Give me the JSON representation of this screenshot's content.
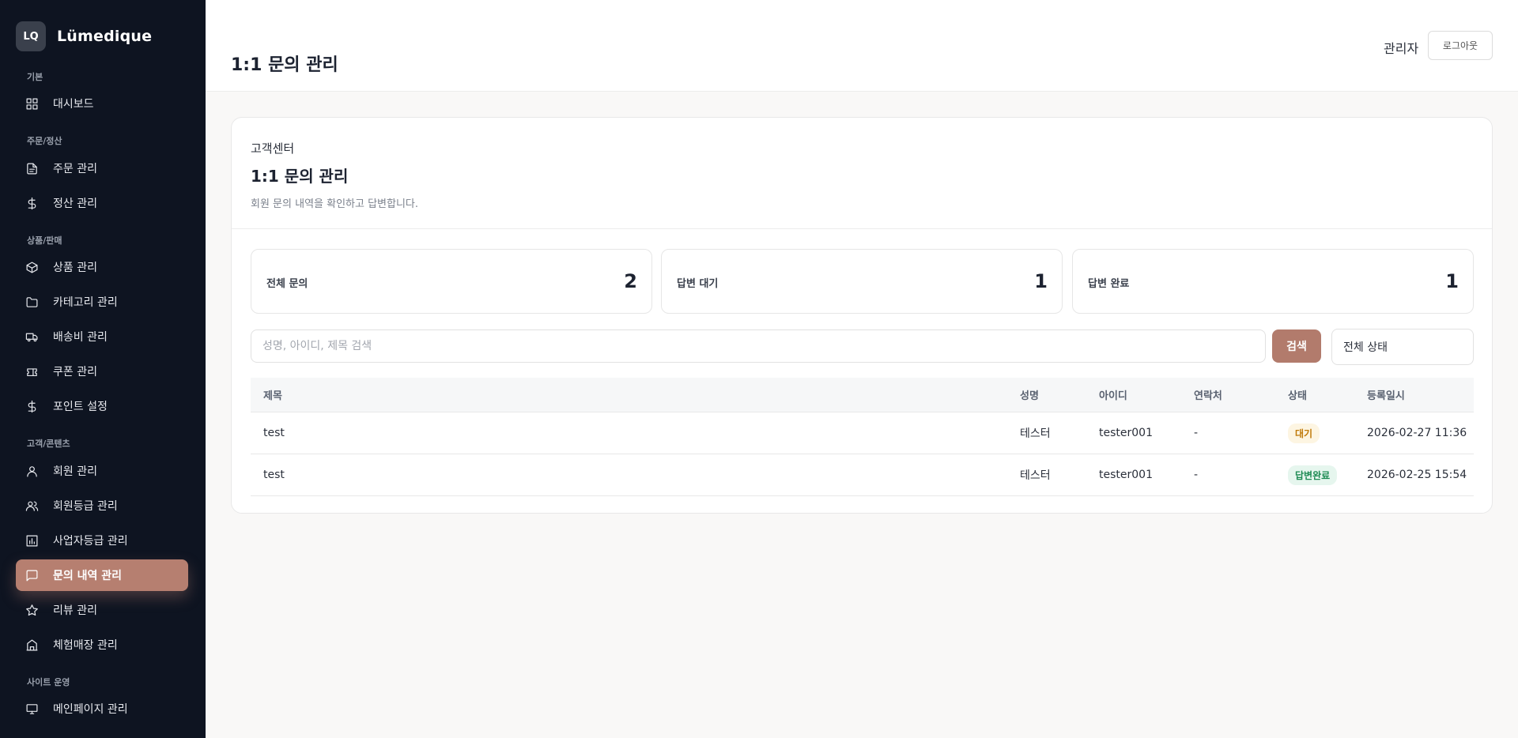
{
  "brand": {
    "logo": "LQ",
    "name": "Lümedique"
  },
  "sidebar": {
    "sections": [
      {
        "label": "기본"
      },
      {
        "label": "주문/정산"
      },
      {
        "label": "상품/판매"
      },
      {
        "label": "고객/콘텐츠"
      },
      {
        "label": "사이트 운영"
      }
    ],
    "items": [
      {
        "label": "대시보드",
        "icon": "grid-icon"
      },
      {
        "label": "주문 관리",
        "icon": "document-icon"
      },
      {
        "label": "정산 관리",
        "icon": "dollar-icon"
      },
      {
        "label": "상품 관리",
        "icon": "box-icon"
      },
      {
        "label": "카테고리 관리",
        "icon": "folder-icon"
      },
      {
        "label": "배송비 관리",
        "icon": "truck-icon"
      },
      {
        "label": "쿠폰 관리",
        "icon": "coupon-icon"
      },
      {
        "label": "포인트 설정",
        "icon": "dollar-icon"
      },
      {
        "label": "회원 관리",
        "icon": "user-icon"
      },
      {
        "label": "회원등급 관리",
        "icon": "users-icon"
      },
      {
        "label": "사업자등급 관리",
        "icon": "bar-chart-icon"
      },
      {
        "label": "문의 내역 관리",
        "icon": "message-icon",
        "active": true
      },
      {
        "label": "리뷰 관리",
        "icon": "star-icon"
      },
      {
        "label": "체험매장 관리",
        "icon": "building-icon"
      },
      {
        "label": "메인페이지 관리",
        "icon": "monitor-icon"
      }
    ]
  },
  "topbar": {
    "title": "1:1 문의 관리",
    "user": "관리자",
    "logout": "로그아웃"
  },
  "card": {
    "eyebrow": "고객센터",
    "title": "1:1 문의 관리",
    "desc": "회원 문의 내역을 확인하고 답변합니다."
  },
  "stats": [
    {
      "label": "전체 문의",
      "value": "2"
    },
    {
      "label": "답변 대기",
      "value": "1"
    },
    {
      "label": "답변 완료",
      "value": "1"
    }
  ],
  "search": {
    "placeholder": "성명, 아이디, 제목 검색",
    "button": "검색",
    "status_filter": "전체 상태"
  },
  "table": {
    "headers": {
      "title": "제목",
      "name": "성명",
      "id": "아이디",
      "phone": "연락처",
      "status": "상태",
      "date": "등록일시"
    },
    "rows": [
      {
        "title": "test",
        "name": "테스터",
        "id": "tester001",
        "phone": "-",
        "status": "대기",
        "date": "2026-02-27 11:36"
      },
      {
        "title": "test",
        "name": "테스터",
        "id": "tester001",
        "phone": "-",
        "status": "답변완료",
        "date": "2026-02-25 15:54"
      }
    ]
  },
  "colors": {
    "accent": "#b67f70",
    "sidebar_bg": "#0e1421",
    "wait": "#c07a0a",
    "done": "#1c8a52"
  }
}
